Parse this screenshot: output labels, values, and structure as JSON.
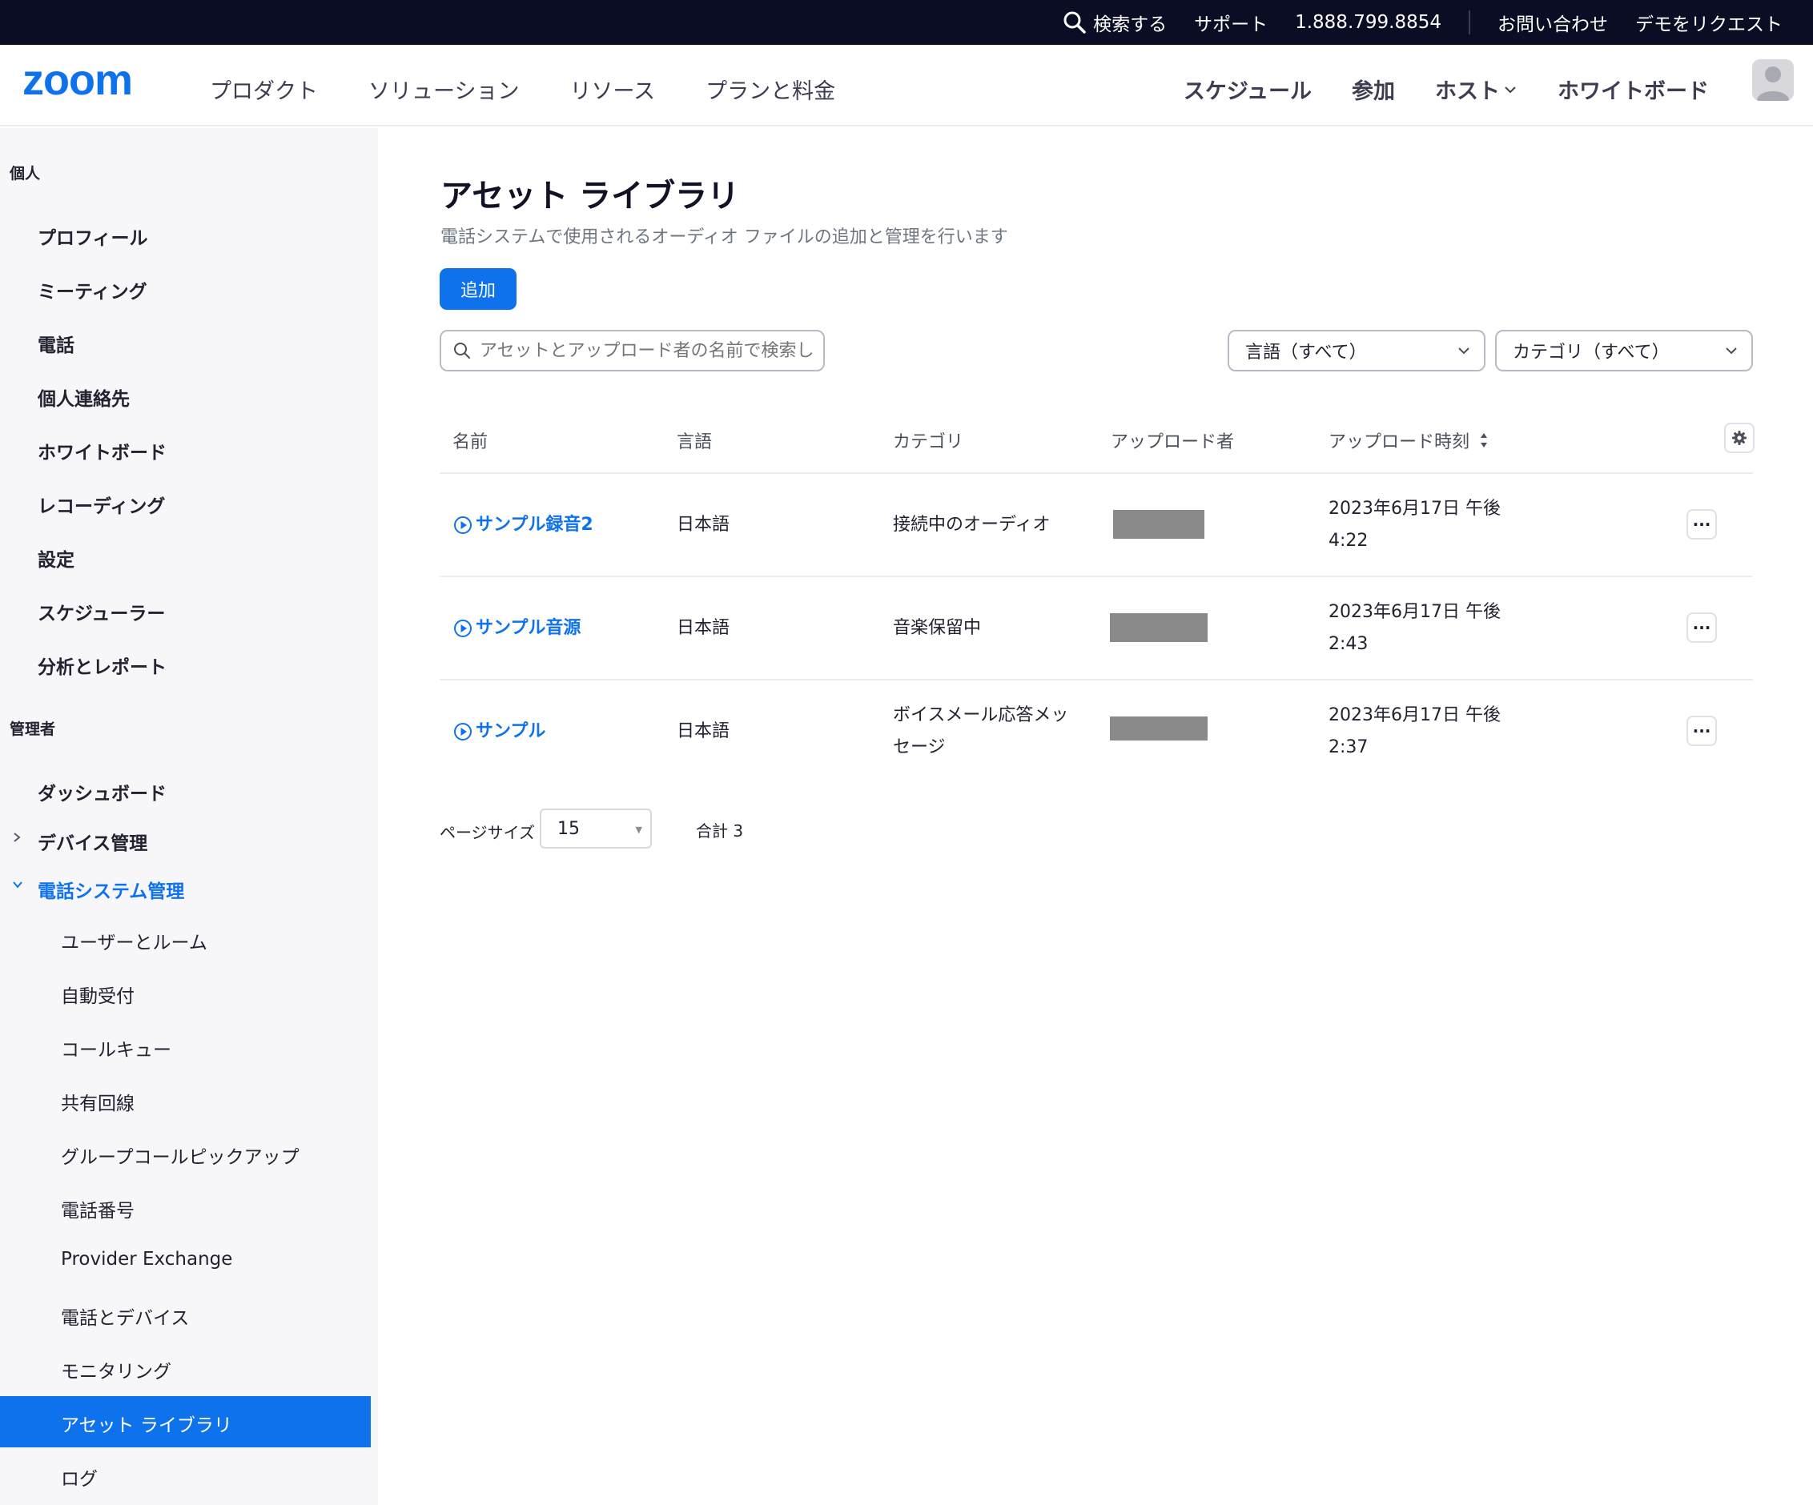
{
  "topbar": {
    "search_label": "検索する",
    "support": "サポート",
    "phone": "1.888.799.8854",
    "contact": "お問い合わせ",
    "demo": "デモをリクエスト"
  },
  "nav": {
    "logo": "zoom",
    "left": [
      "プロダクト",
      "ソリューション",
      "リソース",
      "プランと料金"
    ],
    "right": {
      "schedule": "スケジュール",
      "join": "参加",
      "host": "ホスト",
      "whiteboard": "ホワイトボード"
    }
  },
  "sidebar": {
    "personal_header": "個人",
    "personal_items": [
      "プロフィール",
      "ミーティング",
      "電話",
      "個人連絡先",
      "ホワイトボード",
      "レコーディング",
      "設定",
      "スケジューラー",
      "分析とレポート"
    ],
    "admin_header": "管理者",
    "admin_items": {
      "dashboard": "ダッシュボード",
      "device_mgmt": "デバイス管理",
      "phone_system": "電話システム管理"
    },
    "phone_sub_items": [
      "ユーザーとルーム",
      "自動受付",
      "コールキュー",
      "共有回線",
      "グループコールピックアップ",
      "電話番号",
      "Provider Exchange",
      "電話とデバイス",
      "モニタリング",
      "アセット ライブラリ",
      "ログ"
    ],
    "active_item": "アセット ライブラリ"
  },
  "main": {
    "title": "アセット ライブラリ",
    "description": "電話システムで使用されるオーディオ ファイルの追加と管理を行います",
    "add_button": "追加",
    "search_placeholder": "アセットとアップロード者の名前で検索しま",
    "filter_language": "言語（すべて）",
    "filter_category": "カテゴリ（すべて）",
    "columns": {
      "name": "名前",
      "language": "言語",
      "category": "カテゴリ",
      "uploader": "アップロード者",
      "uploaded_at": "アップロード時刻"
    },
    "rows": [
      {
        "name": "サンプル録音2",
        "language": "日本語",
        "category": "接続中のオーディオ",
        "time_line1": "2023年6月17日 午後",
        "time_line2": "4:22"
      },
      {
        "name": "サンプル音源",
        "language": "日本語",
        "category": "音楽保留中",
        "time_line1": "2023年6月17日 午後",
        "time_line2": "2:43"
      },
      {
        "name": "サンプル",
        "language": "日本語",
        "category_line1": "ボイスメール応答メッ",
        "category_line2": "セージ",
        "time_line1": "2023年6月17日 午後",
        "time_line2": "2:37"
      }
    ],
    "more_label": "···",
    "pager": {
      "label": "ページサイズ",
      "size": "15",
      "total": "合計 3"
    }
  },
  "colors": {
    "accent": "#0e72ed",
    "topbar_bg": "#0b0d24",
    "sidebar_bg": "#f7f7f9",
    "redacted": "#8a8a8a"
  }
}
